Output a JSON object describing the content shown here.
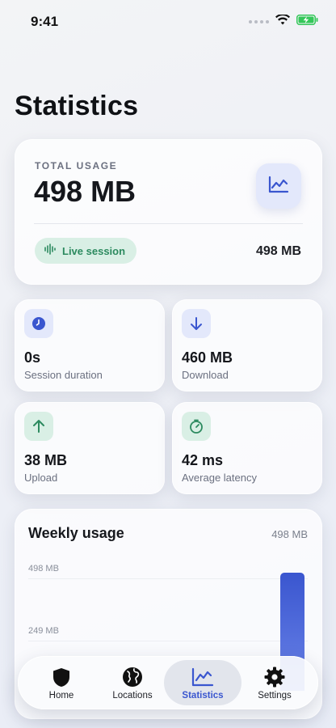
{
  "status": {
    "time": "9:41"
  },
  "page": {
    "title": "Statistics"
  },
  "hero": {
    "label": "TOTAL USAGE",
    "value": "498 MB",
    "live_label": "Live session",
    "right_value": "498 MB"
  },
  "stats": [
    {
      "value": "0s",
      "label": "Session duration",
      "icon": "clock-icon",
      "color": "#3a56cf"
    },
    {
      "value": "460 MB",
      "label": "Download",
      "icon": "arrow-down-icon",
      "color": "#3a56cf"
    },
    {
      "value": "38 MB",
      "label": "Upload",
      "icon": "arrow-up-icon",
      "color": "#2c8a5f"
    },
    {
      "value": "42 ms",
      "label": "Average latency",
      "icon": "timer-icon",
      "color": "#2c8a5f"
    }
  ],
  "weekly": {
    "title": "Weekly usage",
    "total": "498 MB",
    "axis_labels": [
      "498 MB",
      "249 MB"
    ]
  },
  "chart_data": {
    "type": "bar",
    "categories": [],
    "values": [
      498
    ],
    "ylim": [
      0,
      498
    ],
    "title": "Weekly usage",
    "bar_color": "#3a56cf"
  },
  "tabs": [
    {
      "label": "Home",
      "icon": "shield-icon",
      "active": false
    },
    {
      "label": "Locations",
      "icon": "globe-icon",
      "active": false
    },
    {
      "label": "Statistics",
      "icon": "chart-icon",
      "active": true
    },
    {
      "label": "Settings",
      "icon": "gear-icon",
      "active": false
    }
  ],
  "colors": {
    "accent": "#3a56cf",
    "success": "#2c8a5f",
    "battery": "#34c759"
  }
}
